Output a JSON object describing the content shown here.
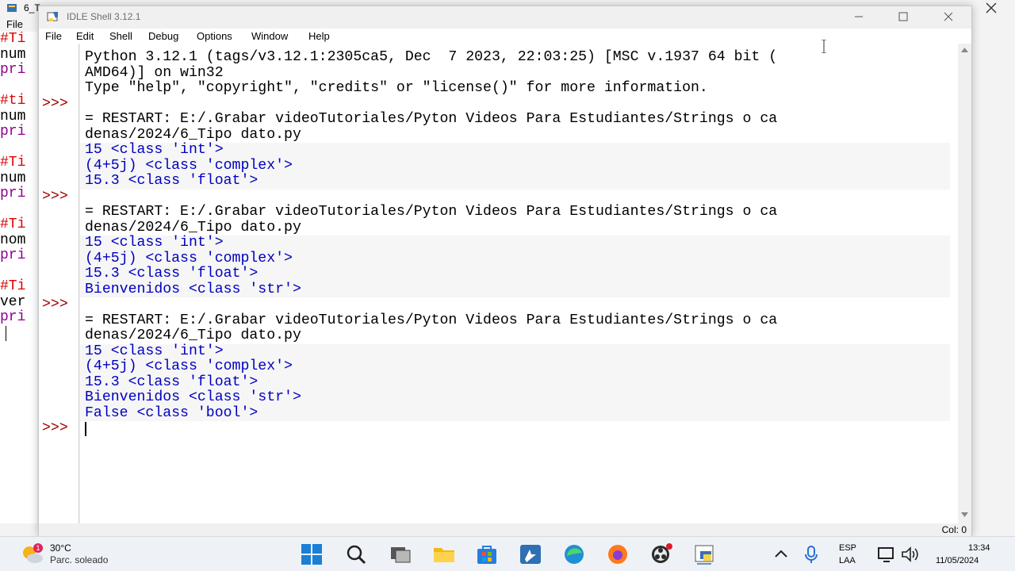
{
  "background_editor": {
    "title": "6_T",
    "menu_file": "File",
    "code_lines": [
      {
        "type": "comment",
        "text": "#Ti"
      },
      {
        "type": "code",
        "text": "num"
      },
      {
        "type": "kw",
        "text": "pri"
      },
      {
        "type": "gap",
        "text": ""
      },
      {
        "type": "comment",
        "text": "#ti"
      },
      {
        "type": "code",
        "text": "num"
      },
      {
        "type": "kw",
        "text": "pri"
      },
      {
        "type": "gap",
        "text": ""
      },
      {
        "type": "comment",
        "text": "#Ti"
      },
      {
        "type": "code",
        "text": "num"
      },
      {
        "type": "kw",
        "text": "pri"
      },
      {
        "type": "gap",
        "text": ""
      },
      {
        "type": "comment",
        "text": "#Ti"
      },
      {
        "type": "code",
        "text": "nom"
      },
      {
        "type": "kw",
        "text": "pri"
      },
      {
        "type": "gap",
        "text": ""
      },
      {
        "type": "comment",
        "text": "#Ti"
      },
      {
        "type": "code",
        "text": "ver"
      },
      {
        "type": "kw",
        "text": "pri"
      }
    ]
  },
  "shell": {
    "title": "IDLE Shell 3.12.1",
    "menu": [
      "File",
      "Edit",
      "Shell",
      "Debug",
      "Options",
      "Window",
      "Help"
    ],
    "prompt": ">>>",
    "status": "Col: 0",
    "lines": [
      {
        "kind": "info",
        "text": "Python 3.12.1 (tags/v3.12.1:2305ca5, Dec  7 2023, 22:03:25) [MSC v.1937 64 bit ("
      },
      {
        "kind": "info",
        "text": "AMD64)] on win32"
      },
      {
        "kind": "info",
        "text": "Type \"help\", \"copyright\", \"credits\" or \"license()\" for more information."
      },
      {
        "kind": "blank",
        "text": "",
        "prompt": true
      },
      {
        "kind": "info",
        "text": "= RESTART: E:/.Grabar videoTutoriales/Pyton Videos Para Estudiantes/Strings o ca"
      },
      {
        "kind": "info",
        "text": "denas/2024/6_Tipo dato.py"
      },
      {
        "kind": "out",
        "text": "15 <class 'int'>"
      },
      {
        "kind": "out",
        "text": "(4+5j) <class 'complex'>"
      },
      {
        "kind": "out",
        "text": "15.3 <class 'float'>"
      },
      {
        "kind": "blank",
        "text": "",
        "prompt": true
      },
      {
        "kind": "info",
        "text": "= RESTART: E:/.Grabar videoTutoriales/Pyton Videos Para Estudiantes/Strings o ca"
      },
      {
        "kind": "info",
        "text": "denas/2024/6_Tipo dato.py"
      },
      {
        "kind": "out",
        "text": "15 <class 'int'>"
      },
      {
        "kind": "out",
        "text": "(4+5j) <class 'complex'>"
      },
      {
        "kind": "out",
        "text": "15.3 <class 'float'>"
      },
      {
        "kind": "out",
        "text": "Bienvenidos <class 'str'>"
      },
      {
        "kind": "blank",
        "text": "",
        "prompt": true
      },
      {
        "kind": "info",
        "text": "= RESTART: E:/.Grabar videoTutoriales/Pyton Videos Para Estudiantes/Strings o ca"
      },
      {
        "kind": "info",
        "text": "denas/2024/6_Tipo dato.py"
      },
      {
        "kind": "out",
        "text": "15 <class 'int'>"
      },
      {
        "kind": "out",
        "text": "(4+5j) <class 'complex'>"
      },
      {
        "kind": "out",
        "text": "15.3 <class 'float'>"
      },
      {
        "kind": "out",
        "text": "Bienvenidos <class 'str'>"
      },
      {
        "kind": "out",
        "text": "False <class 'bool'>"
      },
      {
        "kind": "blank",
        "text": "",
        "prompt": true
      }
    ]
  },
  "taskbar": {
    "weather_temp": "30°C",
    "weather_desc": "Parc. soleado",
    "weather_badge": "1",
    "lang_1": "ESP",
    "lang_2": "LAA",
    "time": "13:34",
    "date": "11/05/2024",
    "icons": [
      "windows-start-icon",
      "search-icon",
      "task-view-icon",
      "file-explorer-icon",
      "store-icon",
      "vscode-icon",
      "edge-icon",
      "firefox-icon",
      "obs-icon",
      "python-idle-icon"
    ]
  },
  "colors": {
    "prompt": "#a00000",
    "output": "#0000c0",
    "comment": "#dd0000",
    "keyword": "#900090"
  }
}
